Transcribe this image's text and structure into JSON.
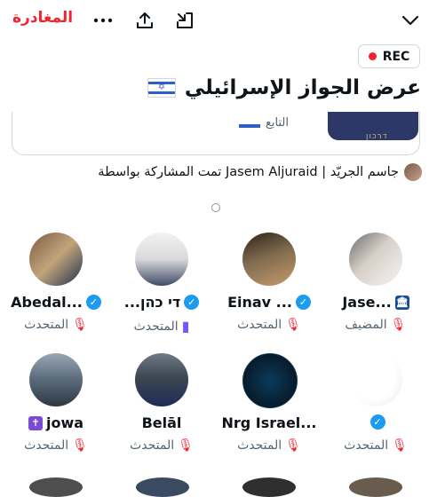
{
  "topbar": {
    "leave_label": "المغادرة",
    "icons": [
      "chevron-down-icon",
      "minimize-icon",
      "share-icon",
      "more-icon"
    ]
  },
  "recording": {
    "label": "REC",
    "color": "#f4212e"
  },
  "space": {
    "title": "عرض الجواز الإسرائيلي",
    "flag": "israel-flag",
    "card_text": "التابع",
    "shared_by": "جاسم الجريّد | Jasem Aljuraid تمت المشاركة بواسطة"
  },
  "participants": [
    {
      "name": "Jase...",
      "role": "المضيف",
      "badge": "institution",
      "verified": false,
      "mic": "off"
    },
    {
      "name": "Einav ...",
      "role": "المتحدث",
      "badge": "verified",
      "verified": true,
      "mic": "off"
    },
    {
      "name": "...די כהן",
      "role": "المتحدث",
      "badge": "verified",
      "verified": true,
      "mic": "active"
    },
    {
      "name": "Abedal...",
      "role": "المتحدث",
      "badge": "verified",
      "verified": true,
      "mic": "off"
    },
    {
      "name": "",
      "role": "المتحدث",
      "badge": "verified",
      "verified": true,
      "mic": "off"
    },
    {
      "name": "Nrg Israel...",
      "role": "المتحدث",
      "badge": "none",
      "verified": false,
      "mic": "off"
    },
    {
      "name": "Belāl",
      "role": "المتحدث",
      "badge": "none",
      "verified": false,
      "mic": "off"
    },
    {
      "name": "jowa",
      "role": "المتحدث",
      "badge": "cross",
      "verified": false,
      "mic": "off"
    }
  ],
  "colors": {
    "accent": "#1d9bf0",
    "danger": "#f4212e",
    "text": "#0f1419",
    "muted": "#536471"
  }
}
